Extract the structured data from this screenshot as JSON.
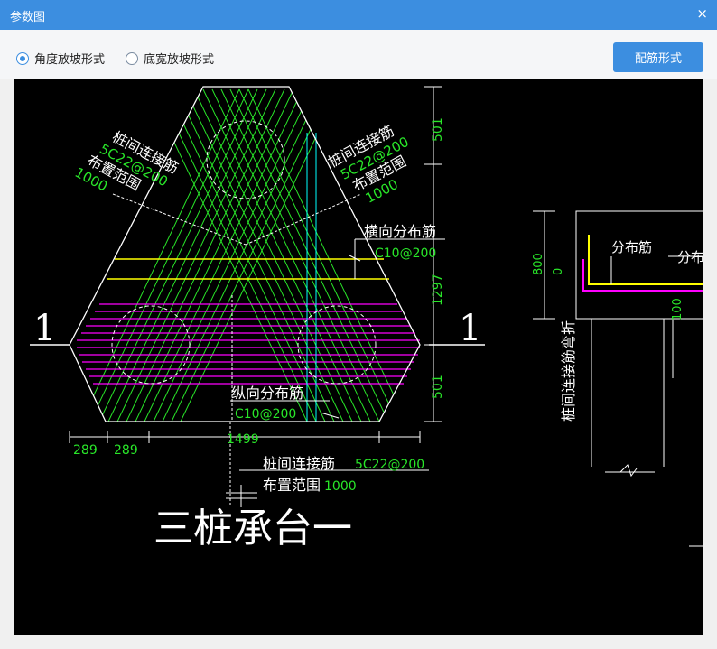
{
  "window": {
    "title": "参数图",
    "close_glyph": "×"
  },
  "options": {
    "angle_slope": "角度放坡形式",
    "width_slope": "底宽放坡形式",
    "selected": "angle_slope"
  },
  "buttons": {
    "rebar_form": "配筋形式"
  },
  "drawing": {
    "section_mark": "1",
    "dim_top": "501",
    "dim_mid": "1297",
    "dim_bottom": "501",
    "dim_289_a": "289",
    "dim_289_b": "289",
    "dim_1499": "1499",
    "left_label_1": "桩间连接筋",
    "left_label_2": "5C22@200",
    "left_label_3": "布置范围",
    "left_label_4": "1000",
    "right_label_1": "桩间连接筋",
    "right_label_2": "5C22@200",
    "right_label_3": "布置范围",
    "right_label_4": "1000",
    "horiz_dist_label": "横向分布筋",
    "horiz_dist_value": "C10@200",
    "long_dist_label": "纵向分布筋",
    "long_dist_value": "C10@200",
    "bottom_conn_label": "桩间连接筋",
    "bottom_conn_value": "5C22@200",
    "bottom_range_label": "布置范围",
    "bottom_range_value": "1000",
    "cap_title": "三桩承台一",
    "side_dim_800": "800",
    "side_dim_0": "0",
    "side_dim_100": "100",
    "side_dist": "分布筋",
    "side_dist_cut": "分布",
    "side_bend": "桩间连接筋弯折"
  },
  "colors": {
    "accent": "#3c8ee0",
    "rebar_green": "#29e629",
    "rebar_magenta": "#ff00ff",
    "rebar_yellow": "#ffff00",
    "rebar_cyan": "#00ffff",
    "line_white": "#ffffff"
  }
}
